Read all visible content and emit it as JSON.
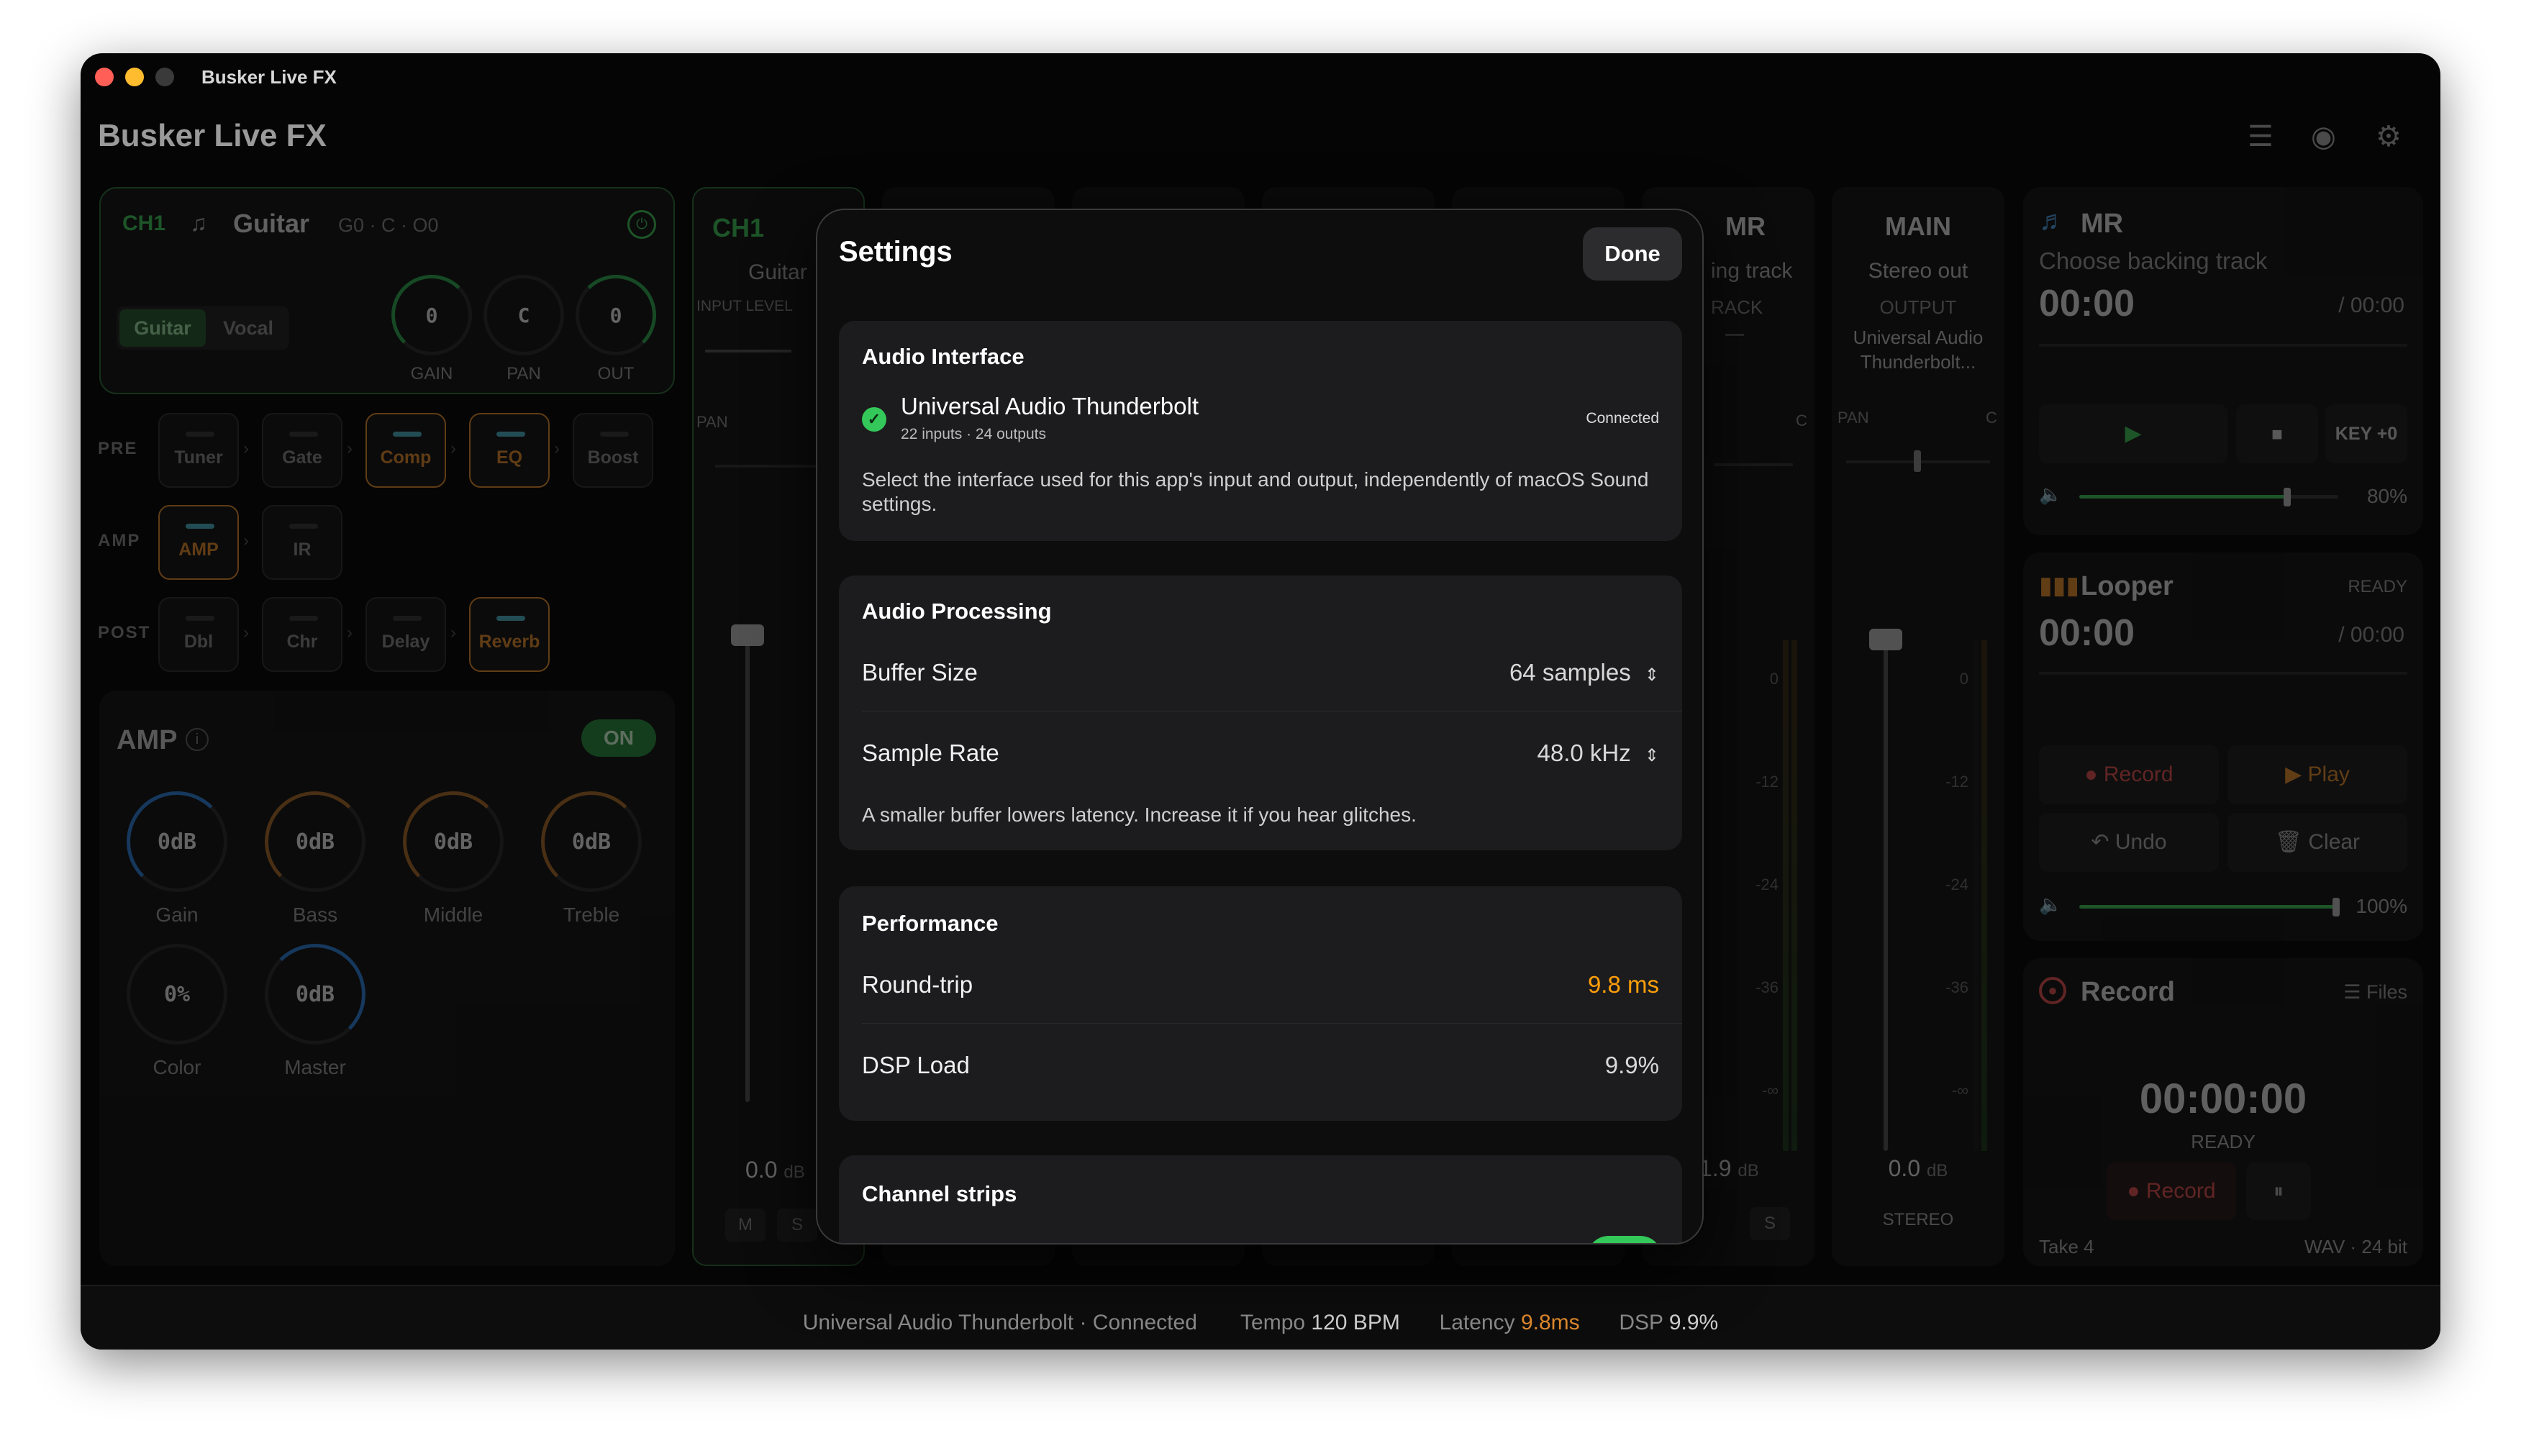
{
  "window": {
    "title": "Busker Live FX"
  },
  "app": {
    "title": "Busker Live FX"
  },
  "channel": {
    "id": "CH1",
    "name": "Guitar",
    "info": "G0 · C · O0",
    "modes": [
      "Guitar",
      "Vocal"
    ],
    "knobs": [
      {
        "value": "0",
        "label": "GAIN"
      },
      {
        "value": "C",
        "label": "PAN"
      },
      {
        "value": "0",
        "label": "OUT"
      }
    ]
  },
  "chain": {
    "pre_label": "PRE",
    "amp_label": "AMP",
    "post_label": "POST",
    "pre": [
      "Tuner",
      "Gate",
      "Comp",
      "EQ",
      "Boost"
    ],
    "amp": [
      "AMP",
      "IR"
    ],
    "post": [
      "Dbl",
      "Chr",
      "Delay",
      "Reverb"
    ]
  },
  "amp_panel": {
    "title": "AMP",
    "status": "ON",
    "knobs": [
      {
        "value": "0dB",
        "label": "Gain"
      },
      {
        "value": "0dB",
        "label": "Bass"
      },
      {
        "value": "0dB",
        "label": "Middle"
      },
      {
        "value": "0dB",
        "label": "Treble"
      },
      {
        "value": "0%",
        "label": "Color"
      },
      {
        "value": "0dB",
        "label": "Master"
      }
    ]
  },
  "strip_ch1": {
    "id": "CH1",
    "name": "Guitar",
    "input_label": "INPUT LEVEL",
    "pan_label": "PAN",
    "level": "0.0",
    "unit": "dB",
    "mute": "M",
    "solo": "S"
  },
  "strip_mr": {
    "id": "MR",
    "name": "ing track",
    "sub": "RACK",
    "dash": "—",
    "pan_c": "C",
    "level": "1.9",
    "unit": "dB",
    "solo": "S"
  },
  "strip_main": {
    "id": "MAIN",
    "name": "Stereo out",
    "output_label": "OUTPUT",
    "device_line1": "Universal Audio",
    "device_line2": "Thunderbolt...",
    "pan_label": "PAN",
    "pan_c": "C",
    "level": "0.0",
    "unit": "dB",
    "mode": "STEREO"
  },
  "meter_scale": [
    "0",
    "-12",
    "-24",
    "-36",
    "-∞"
  ],
  "mr_panel": {
    "title": "MR",
    "subtitle": "Choose backing track",
    "time": "00:00",
    "total": "/ 00:00",
    "key": "KEY +0",
    "volume": "80%"
  },
  "looper": {
    "title": "Looper",
    "status": "READY",
    "time": "00:00",
    "total": "/ 00:00",
    "record": "Record",
    "play": "Play",
    "undo": "Undo",
    "clear": "Clear",
    "volume": "100%"
  },
  "recorder": {
    "title": "Record",
    "files": "Files",
    "time": "00:00:00",
    "status": "READY",
    "record": "Record",
    "pause": "⏸",
    "take": "Take 4",
    "format": "WAV · 24 bit"
  },
  "footer": {
    "device": "Universal Audio Thunderbolt · Connected",
    "tempo_label": "Tempo",
    "tempo": "120 BPM",
    "latency_label": "Latency",
    "latency": "9.8ms",
    "dsp_label": "DSP",
    "dsp": "9.9%"
  },
  "settings": {
    "title": "Settings",
    "done": "Done",
    "audio_interface": {
      "heading": "Audio Interface",
      "device": "Universal Audio Thunderbolt",
      "io": "22 inputs · 24 outputs",
      "status": "Connected",
      "note": "Select the interface used for this app's input and output, independently of macOS Sound settings."
    },
    "audio_processing": {
      "heading": "Audio Processing",
      "buffer_label": "Buffer Size",
      "buffer_value": "64 samples",
      "rate_label": "Sample Rate",
      "rate_value": "48.0 kHz",
      "note": "A smaller buffer lowers latency. Increase it if you hear glitches."
    },
    "performance": {
      "heading": "Performance",
      "roundtrip_label": "Round-trip",
      "roundtrip_value": "9.8 ms",
      "dsp_label": "DSP Load",
      "dsp_value": "9.9%"
    },
    "channel_strips": {
      "heading": "Channel strips"
    }
  },
  "colors": {
    "accent_green": "#34c759",
    "accent_orange": "#ff9f0a",
    "knob_blue": "#2f7fd6",
    "knob_bronze": "#a8692a",
    "knob_green": "#2fa84f"
  }
}
